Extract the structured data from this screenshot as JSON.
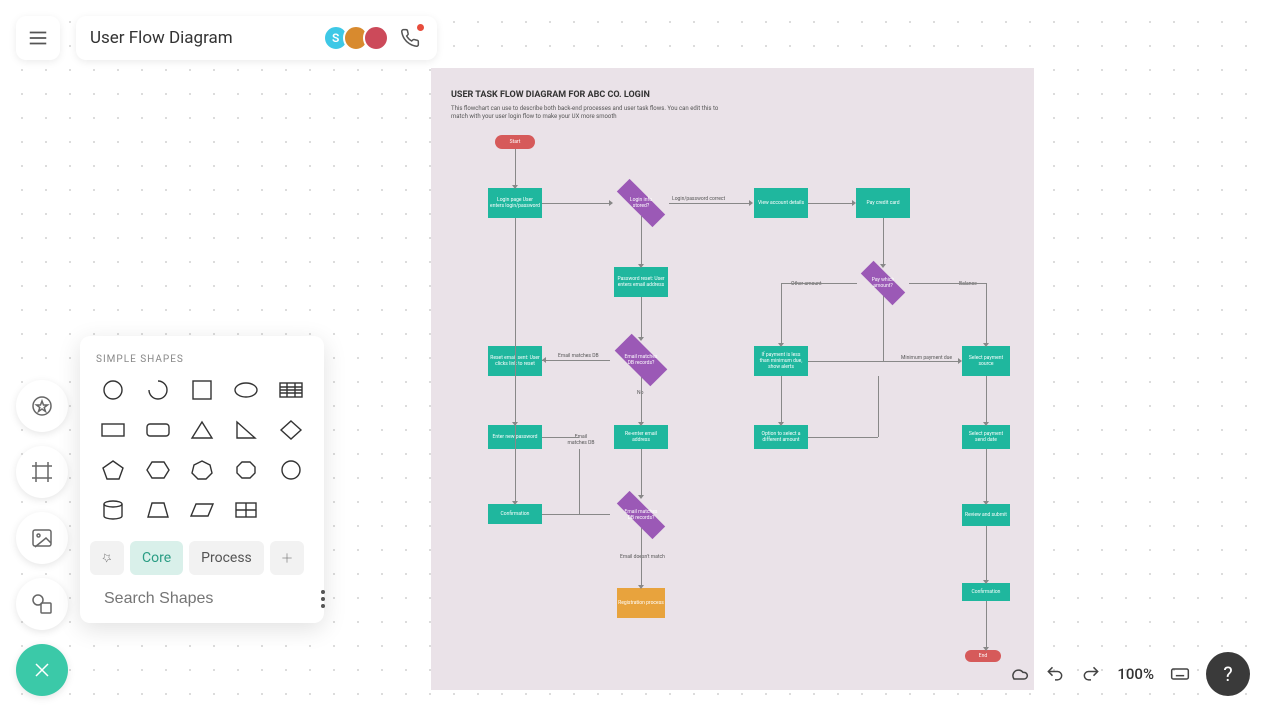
{
  "header": {
    "title": "User Flow Diagram",
    "avatars": [
      {
        "bg": "#3ec8e6",
        "initial": "S"
      },
      {
        "bg": "#d88a2e",
        "initial": ""
      },
      {
        "bg": "#cc4a5a",
        "initial": ""
      }
    ]
  },
  "shapes_panel": {
    "label": "SIMPLE SHAPES",
    "tabs": {
      "core": "Core",
      "process": "Process"
    },
    "search_placeholder": "Search Shapes"
  },
  "flowchart": {
    "title": "USER TASK FLOW DIAGRAM FOR ABC CO. LOGIN",
    "description": "This flowchart can use to describe both back-end processes and user task flows. You can edit this to match with your user login flow to make your UX more smooth",
    "nodes": {
      "start": "Start",
      "login_page": "Login page User enters login/password",
      "login_stored": "Login info stored?",
      "view_account": "View account details",
      "pay_card": "Pay credit card",
      "pw_reset": "Password reset: User enters email address",
      "email_matches": "Email matches DB records?",
      "reset_sent": "Reset email sent: User clicks link to reset",
      "reenter_email": "Re-enter email address",
      "enter_pw": "Enter new password",
      "email_matches2": "Email matches DB records?",
      "confirmation": "Confirmation",
      "registration": "Registration process",
      "pay_which": "Pay which amount?",
      "pay_less": "If payment is less than minimum due, show alerts",
      "select_src": "Select payment source",
      "option_diff": "Option to select a different amount",
      "select_date": "Select payment send date",
      "review": "Review and submit",
      "confirmation2": "Confirmation",
      "end": "End"
    },
    "edge_labels": {
      "login_correct": "Login/password correct",
      "email_match_db": "Email matches DB",
      "email_match_db2": "Email matches DB",
      "no": "No",
      "no_match": "Email doesn't match",
      "other": "Other amount",
      "balance": "Balance",
      "min_due": "Minimum payment due"
    }
  },
  "status": {
    "zoom": "100%"
  }
}
